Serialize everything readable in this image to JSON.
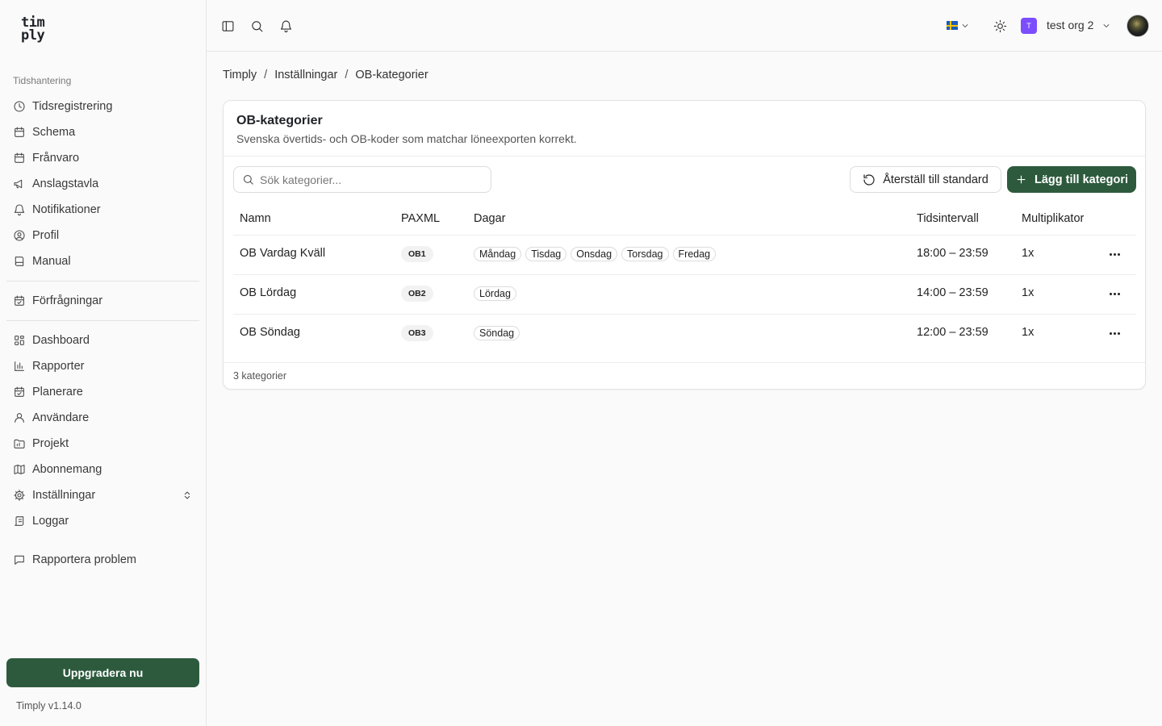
{
  "logo": {
    "line1": "tim",
    "line2": "ply"
  },
  "sidebar": {
    "section_label": "Tidshantering",
    "group1": [
      {
        "label": "Tidsregistrering",
        "icon": "clock-icon"
      },
      {
        "label": "Schema",
        "icon": "calendar-icon"
      },
      {
        "label": "Frånvaro",
        "icon": "calendar-icon"
      },
      {
        "label": "Anslagstavla",
        "icon": "megaphone-icon"
      },
      {
        "label": "Notifikationer",
        "icon": "bell-icon"
      },
      {
        "label": "Profil",
        "icon": "user-circle-icon"
      },
      {
        "label": "Manual",
        "icon": "book-icon"
      }
    ],
    "group2": [
      {
        "label": "Förfrågningar",
        "icon": "calendar-check-icon"
      }
    ],
    "group3": [
      {
        "label": "Dashboard",
        "icon": "dashboard-icon"
      },
      {
        "label": "Rapporter",
        "icon": "bar-chart-icon"
      },
      {
        "label": "Planerare",
        "icon": "calendar-check-icon"
      },
      {
        "label": "Användare",
        "icon": "user-icon"
      },
      {
        "label": "Projekt",
        "icon": "folder-icon"
      },
      {
        "label": "Abonnemang",
        "icon": "map-icon"
      },
      {
        "label": "Inställningar",
        "icon": "gear-icon"
      },
      {
        "label": "Loggar",
        "icon": "scroll-icon"
      }
    ],
    "report_problem": "Rapportera problem",
    "upgrade_label": "Uppgradera nu",
    "version": "Timply v1.14.0"
  },
  "topbar": {
    "org_badge": "T",
    "org_name": "test org 2"
  },
  "breadcrumb": [
    "Timply",
    "Inställningar",
    "OB-kategorier"
  ],
  "card": {
    "title": "OB-kategorier",
    "description": "Svenska övertids- och OB-koder som matchar löneexporten korrekt.",
    "search_placeholder": "Sök kategorier...",
    "reset_label": "Återställ till standard",
    "add_label": "Lägg till kategori",
    "columns": [
      "Namn",
      "PAXML",
      "Dagar",
      "Tidsintervall",
      "Multiplikator"
    ],
    "rows": [
      {
        "name": "OB Vardag Kväll",
        "code": "OB1",
        "days": [
          "Måndag",
          "Tisdag",
          "Onsdag",
          "Torsdag",
          "Fredag"
        ],
        "interval": "18:00 – 23:59",
        "multiplier": "1x"
      },
      {
        "name": "OB Lördag",
        "code": "OB2",
        "days": [
          "Lördag"
        ],
        "interval": "14:00 – 23:59",
        "multiplier": "1x"
      },
      {
        "name": "OB Söndag",
        "code": "OB3",
        "days": [
          "Söndag"
        ],
        "interval": "12:00 – 23:59",
        "multiplier": "1x"
      }
    ],
    "footer": "3 kategorier"
  },
  "colors": {
    "primary": "#2d5a3d",
    "org_badge": "#7c4dff"
  }
}
